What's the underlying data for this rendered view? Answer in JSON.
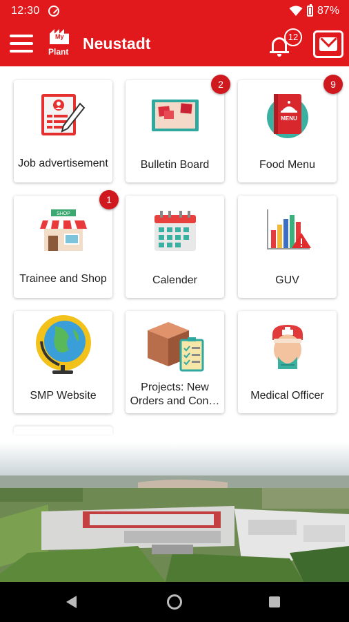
{
  "status_bar": {
    "time": "12:30",
    "battery": "87%"
  },
  "app_bar": {
    "title": "Neustadt",
    "logo_text": "Plant",
    "logo_sub": "My",
    "notification_count": "12"
  },
  "tiles": [
    {
      "label": "Job advertisement",
      "badge": ""
    },
    {
      "label": "Bulletin Board",
      "badge": "2"
    },
    {
      "label": "Food Menu",
      "badge": "9"
    },
    {
      "label": "Trainee and Shop",
      "badge": "1"
    },
    {
      "label": "Calender",
      "badge": ""
    },
    {
      "label": "GUV",
      "badge": ""
    },
    {
      "label": "SMP Website",
      "badge": ""
    },
    {
      "label": "Projects: New Orders and Con…",
      "badge": ""
    },
    {
      "label": "Medical Officer",
      "badge": ""
    }
  ],
  "icons": {
    "tile_icons": [
      "job-advertisement-icon",
      "bulletin-board-icon",
      "food-menu-icon",
      "trainee-shop-icon",
      "calendar-icon",
      "guv-chart-icon",
      "globe-icon",
      "projects-box-icon",
      "medical-officer-icon"
    ],
    "shop_sign": "SHOP",
    "menu_book": "MENU"
  },
  "colors": {
    "brand_red": "#e1191d",
    "badge_red": "#d0191f"
  }
}
